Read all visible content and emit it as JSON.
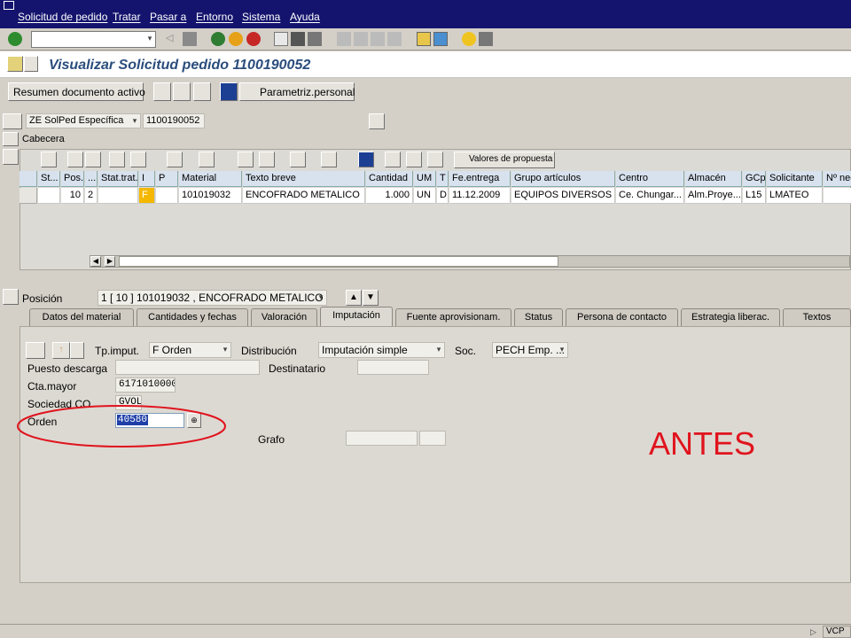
{
  "menu": [
    "Solicitud de pedido",
    "Tratar",
    "Pasar a",
    "Entorno",
    "Sistema",
    "Ayuda"
  ],
  "title": "Visualizar Solicitud pedido 1100190052",
  "app_toolbar": {
    "summary_label": "Resumen documento activo",
    "personal_label": "Parametriz.personal"
  },
  "header": {
    "doc_type": "ZE SolPed Específica",
    "doc_number": "1100190052",
    "cabecera_label": "Cabecera"
  },
  "grid_toolbar": {
    "proposal_values_label": "Valores de propuesta"
  },
  "grid": {
    "columns": [
      "St...",
      "Pos.",
      "...",
      "Stat.trat.",
      "I",
      "P",
      "Material",
      "Texto breve",
      "Cantidad",
      "UM",
      "T",
      "Fe.entrega",
      "Grupo artículos",
      "Centro",
      "Almacén",
      "GCp",
      "Solicitante",
      "Nº nec."
    ],
    "row": [
      "",
      "10",
      "2",
      "",
      "F",
      "",
      "101019032",
      "ENCOFRADO METALICO",
      "1.000",
      "UN",
      "D",
      "11.12.2009",
      "EQUIPOS DIVERSOS",
      "Ce. Chungar...",
      "Alm.Proye...",
      "L15",
      "LMATEO",
      ""
    ]
  },
  "position": {
    "label": "Posición",
    "value": "1 [ 10 ] 101019032 , ENCOFRADO METALICO"
  },
  "tabs": [
    "Datos del material",
    "Cantidades y fechas",
    "Valoración",
    "Imputación",
    "Fuente aprovisionam.",
    "Status",
    "Persona de contacto",
    "Estrategia liberac.",
    "Textos"
  ],
  "active_tab": "Imputación",
  "imputacion": {
    "tp_label": "Tp.imput.",
    "tp_value": "F Orden",
    "dist_label": "Distribución",
    "dist_value": "Imputación simple",
    "soc_label": "Soc.",
    "soc_value": "PECH Emp. ...",
    "puesto_label": "Puesto descarga",
    "puesto_value": "",
    "dest_label": "Destinatario",
    "dest_value": "",
    "cta_label": "Cta.mayor",
    "cta_value": "6171010000",
    "sociedad_label": "Sociedad CO",
    "sociedad_value": "GVOL",
    "orden_label": "Orden",
    "orden_value": "40580",
    "grafo_label": "Grafo"
  },
  "annotation": "ANTES",
  "status_bar": {
    "system": "VCP"
  },
  "colors": {
    "menubar": "#14146e",
    "title": "#2b4d7d",
    "annotation": "#e0141e",
    "selection": "#1f3fa8"
  }
}
